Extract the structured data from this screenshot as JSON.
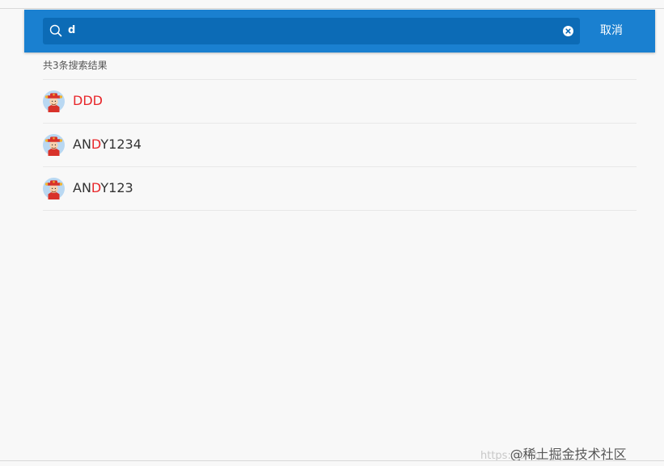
{
  "search": {
    "query": "d",
    "cancel_label": "取消"
  },
  "results": {
    "count_text": "共3条搜索结果",
    "highlight_color": "#e8262a",
    "items": [
      {
        "pre": "",
        "match": "DDD",
        "post": ""
      },
      {
        "pre": "AN",
        "match": "D",
        "post": "Y1234"
      },
      {
        "pre": "AN",
        "match": "D",
        "post": "Y123"
      }
    ]
  },
  "colors": {
    "header": "#1a80d0",
    "search_box": "#0c6bb6"
  },
  "icons": {
    "search": "search-icon",
    "clear": "clear-icon",
    "avatar": "avatar-icon"
  },
  "watermark": {
    "url": "https://blog",
    "brand": "@稀土掘金技术社区"
  }
}
